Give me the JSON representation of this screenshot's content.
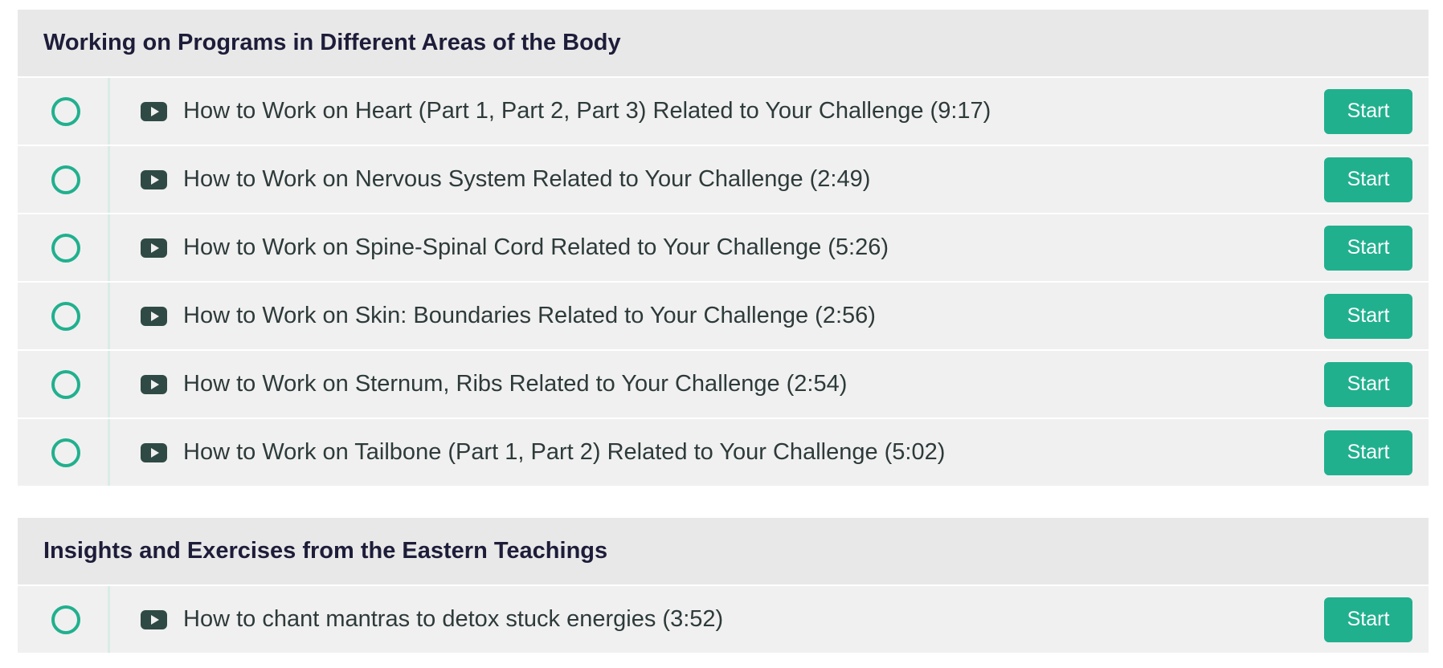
{
  "sections": [
    {
      "title": "Working on Programs in Different Areas of the Body",
      "lectures": [
        {
          "name": "How to Work on Heart (Part 1, Part 2, Part 3) Related to Your Challenge (9:17)",
          "button": "Start"
        },
        {
          "name": "How to Work on Nervous System Related to Your Challenge (2:49)",
          "button": "Start"
        },
        {
          "name": "How to Work on Spine-Spinal Cord Related to Your Challenge (5:26)",
          "button": "Start"
        },
        {
          "name": "How to Work on Skin: Boundaries Related to Your Challenge (2:56)",
          "button": "Start"
        },
        {
          "name": "How to Work on Sternum, Ribs Related to Your Challenge (2:54)",
          "button": "Start"
        },
        {
          "name": "How to Work on Tailbone (Part 1, Part 2) Related to Your Challenge (5:02)",
          "button": "Start"
        }
      ]
    },
    {
      "title": "Insights and Exercises from the Eastern Teachings",
      "lectures": [
        {
          "name": "How to chant mantras to detox stuck energies (3:52)",
          "button": "Start"
        }
      ]
    }
  ],
  "icons": {
    "status": "incomplete-circle-icon",
    "lecture_type": "video-play-icon"
  },
  "colors": {
    "accent": "#21b08e",
    "header_bg": "#e8e8e8",
    "row_bg": "#f0f0f0",
    "title_text": "#1d1d3a",
    "body_text": "#2e3a3a",
    "icon": "#2f4a44"
  }
}
